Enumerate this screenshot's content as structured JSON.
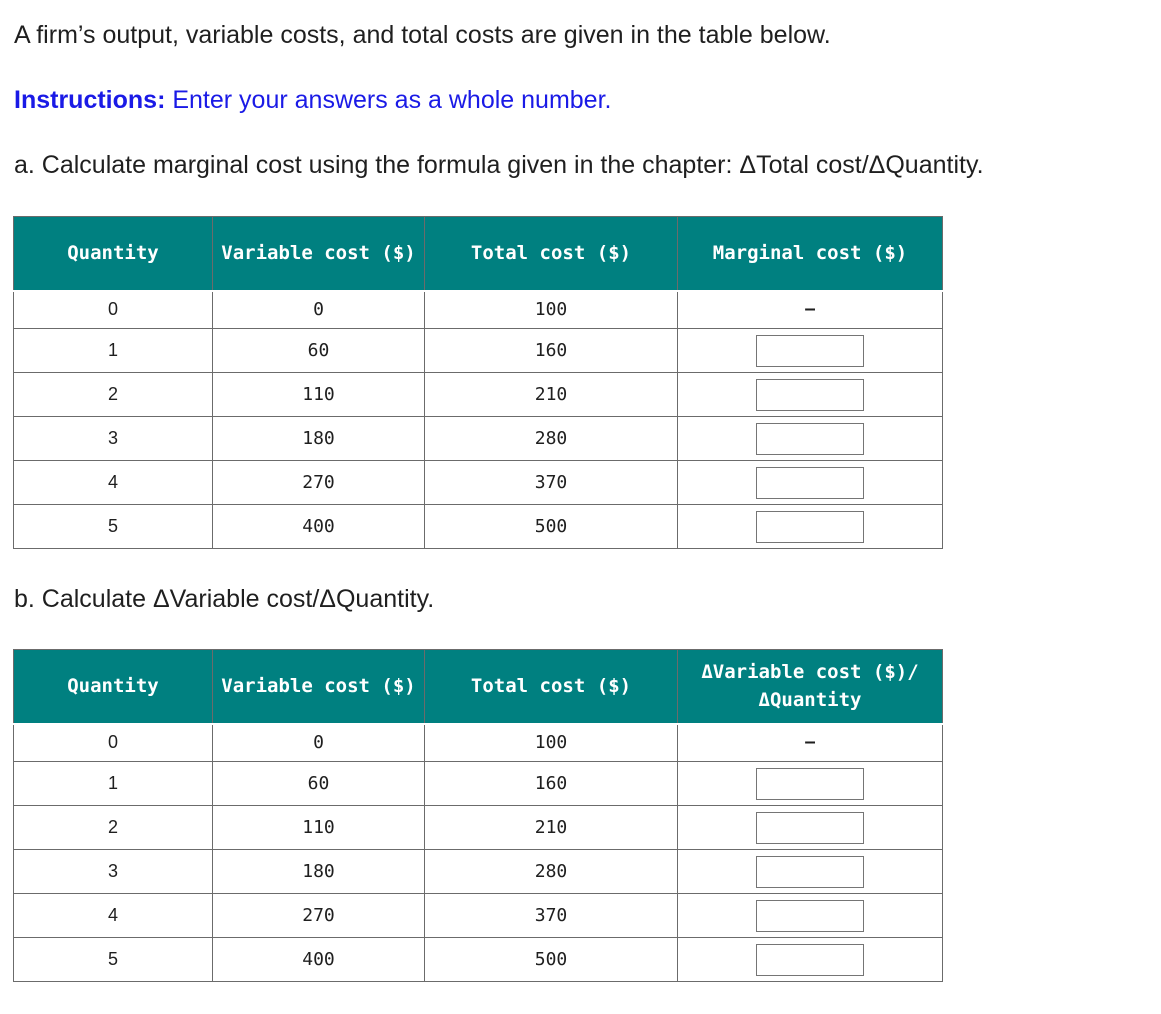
{
  "intro": "A firm’s output, variable costs, and total costs are given in the table below.",
  "instructions": {
    "lead": "Instructions:",
    "text": " Enter your answers as a whole number."
  },
  "part_a": {
    "title": "a. Calculate marginal cost using the formula given in the chapter: ΔTotal cost/ΔQuantity.",
    "headers": [
      "Quantity",
      "Variable cost ($)",
      "Total cost ($)",
      "Marginal cost ($)"
    ],
    "rows": [
      {
        "quantity": "0",
        "variable_cost": "0",
        "total_cost": "100",
        "answer": "–"
      },
      {
        "quantity": "1",
        "variable_cost": "60",
        "total_cost": "160",
        "answer": ""
      },
      {
        "quantity": "2",
        "variable_cost": "110",
        "total_cost": "210",
        "answer": ""
      },
      {
        "quantity": "3",
        "variable_cost": "180",
        "total_cost": "280",
        "answer": ""
      },
      {
        "quantity": "4",
        "variable_cost": "270",
        "total_cost": "370",
        "answer": ""
      },
      {
        "quantity": "5",
        "variable_cost": "400",
        "total_cost": "500",
        "answer": ""
      }
    ]
  },
  "part_b": {
    "title": "b. Calculate ΔVariable cost/ΔQuantity.",
    "headers": [
      "Quantity",
      "Variable cost ($)",
      "Total cost ($)",
      "ΔVariable cost ($)/ ΔQuantity"
    ],
    "rows": [
      {
        "quantity": "0",
        "variable_cost": "0",
        "total_cost": "100",
        "answer": "–"
      },
      {
        "quantity": "1",
        "variable_cost": "60",
        "total_cost": "160",
        "answer": ""
      },
      {
        "quantity": "2",
        "variable_cost": "110",
        "total_cost": "210",
        "answer": ""
      },
      {
        "quantity": "3",
        "variable_cost": "180",
        "total_cost": "280",
        "answer": ""
      },
      {
        "quantity": "4",
        "variable_cost": "270",
        "total_cost": "370",
        "answer": ""
      },
      {
        "quantity": "5",
        "variable_cost": "400",
        "total_cost": "500",
        "answer": ""
      }
    ]
  },
  "colors": {
    "header_background": "#008080",
    "instructions_text": "#1a1ae6"
  }
}
